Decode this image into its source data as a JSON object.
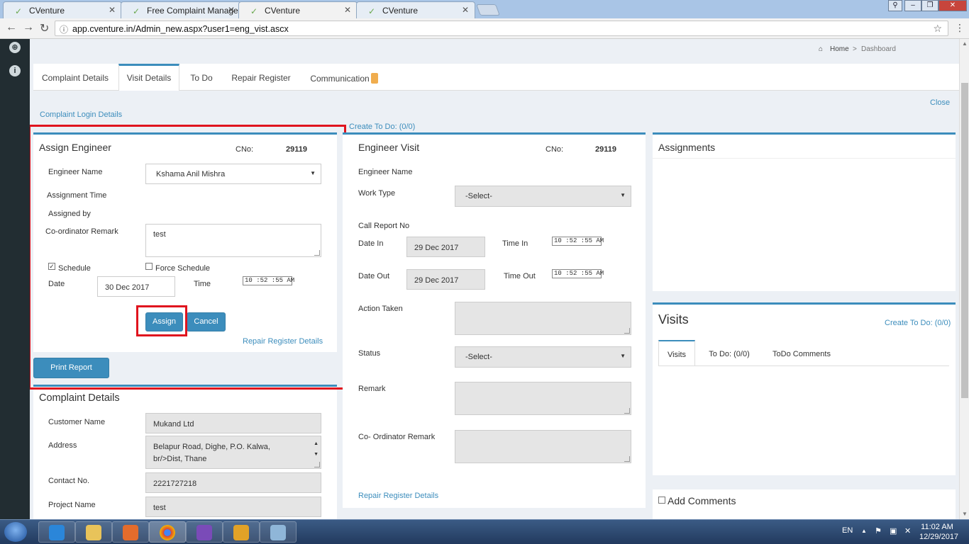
{
  "browser": {
    "tabs": [
      {
        "title": "CVenture",
        "active": false
      },
      {
        "title": "Free Complaint Managen",
        "active": false
      },
      {
        "title": "CVenture",
        "active": true
      },
      {
        "title": "CVenture",
        "active": false
      }
    ],
    "url": "app.cventure.in/Admin_new.aspx?user1=eng_vist.ascx"
  },
  "breadcrumb": {
    "home": "Home",
    "sep": ">",
    "current": "Dashboard"
  },
  "tabs": [
    {
      "label": "Complaint Details"
    },
    {
      "label": "Visit Details"
    },
    {
      "label": "To Do"
    },
    {
      "label": "Repair Register"
    },
    {
      "label": "Communication"
    }
  ],
  "links": {
    "complaint_login": "Complaint Login Details",
    "create_todo": "Create To Do: (0/0)",
    "close": "Close",
    "create_todo_visits": "Create To Do: (0/0)",
    "repair_register_assign": "Repair Register Details",
    "repair_register_visit": "Repair Register Details"
  },
  "assign_engineer": {
    "title": "Assign Engineer",
    "cno_label": "CNo:",
    "cno_value": "29119",
    "engineer_name_label": "Engineer Name",
    "engineer_name_value": "Kshama Anil Mishra",
    "assignment_time_label": "Assignment Time",
    "assigned_by_label": "Assigned by",
    "coordinator_remark_label": "Co-ordinator Remark",
    "coordinator_remark_value": "test",
    "schedule_label": "Schedule",
    "schedule_checked": true,
    "force_schedule_label": "Force Schedule",
    "force_schedule_checked": false,
    "date_label": "Date",
    "date_value": "30 Dec 2017",
    "time_label": "Time",
    "time_value": "10 :52 :55 AM",
    "assign_button": "Assign",
    "cancel_button": "Cancel"
  },
  "print_report_button": "Print Report",
  "complaint_details": {
    "title": "Complaint Details",
    "customer_name_label": "Customer Name",
    "customer_name_value": "Mukand Ltd",
    "address_label": "Address",
    "address_line1": "Belapur Road, Dighe, P.O. Kalwa,",
    "address_line2": "br/>Dist, Thane",
    "contact_label": "Contact No.",
    "contact_value": "2221727218",
    "project_label": "Project Name",
    "project_value": "test"
  },
  "engineer_visit": {
    "title": "Engineer Visit",
    "cno_label": "CNo:",
    "cno_value": "29119",
    "engineer_name_label": "Engineer Name",
    "work_type_label": "Work Type",
    "work_type_value": "-Select-",
    "call_report_label": "Call Report No",
    "date_in_label": "Date In",
    "date_in_value": "29 Dec 2017",
    "time_in_label": "Time In",
    "time_in_value": "10 :52 :55 AM",
    "date_out_label": "Date Out",
    "date_out_value": "29 Dec 2017",
    "time_out_label": "Time Out",
    "time_out_value": "10 :52 :55 AM",
    "action_taken_label": "Action Taken",
    "status_label": "Status",
    "status_value": "-Select-",
    "remark_label": "Remark",
    "coordinator_remark_label": "Co- Ordinator Remark"
  },
  "assignments": {
    "title": "Assignments"
  },
  "visits": {
    "title": "Visits",
    "subtabs": [
      {
        "label": "Visits"
      },
      {
        "label": "To Do: (0/0)"
      },
      {
        "label": "ToDo Comments"
      }
    ]
  },
  "add_comments": {
    "label": "Add Comments",
    "checked": false
  },
  "taskbar": {
    "lang": "EN",
    "time": "11:02 AM",
    "date": "12/29/2017"
  }
}
